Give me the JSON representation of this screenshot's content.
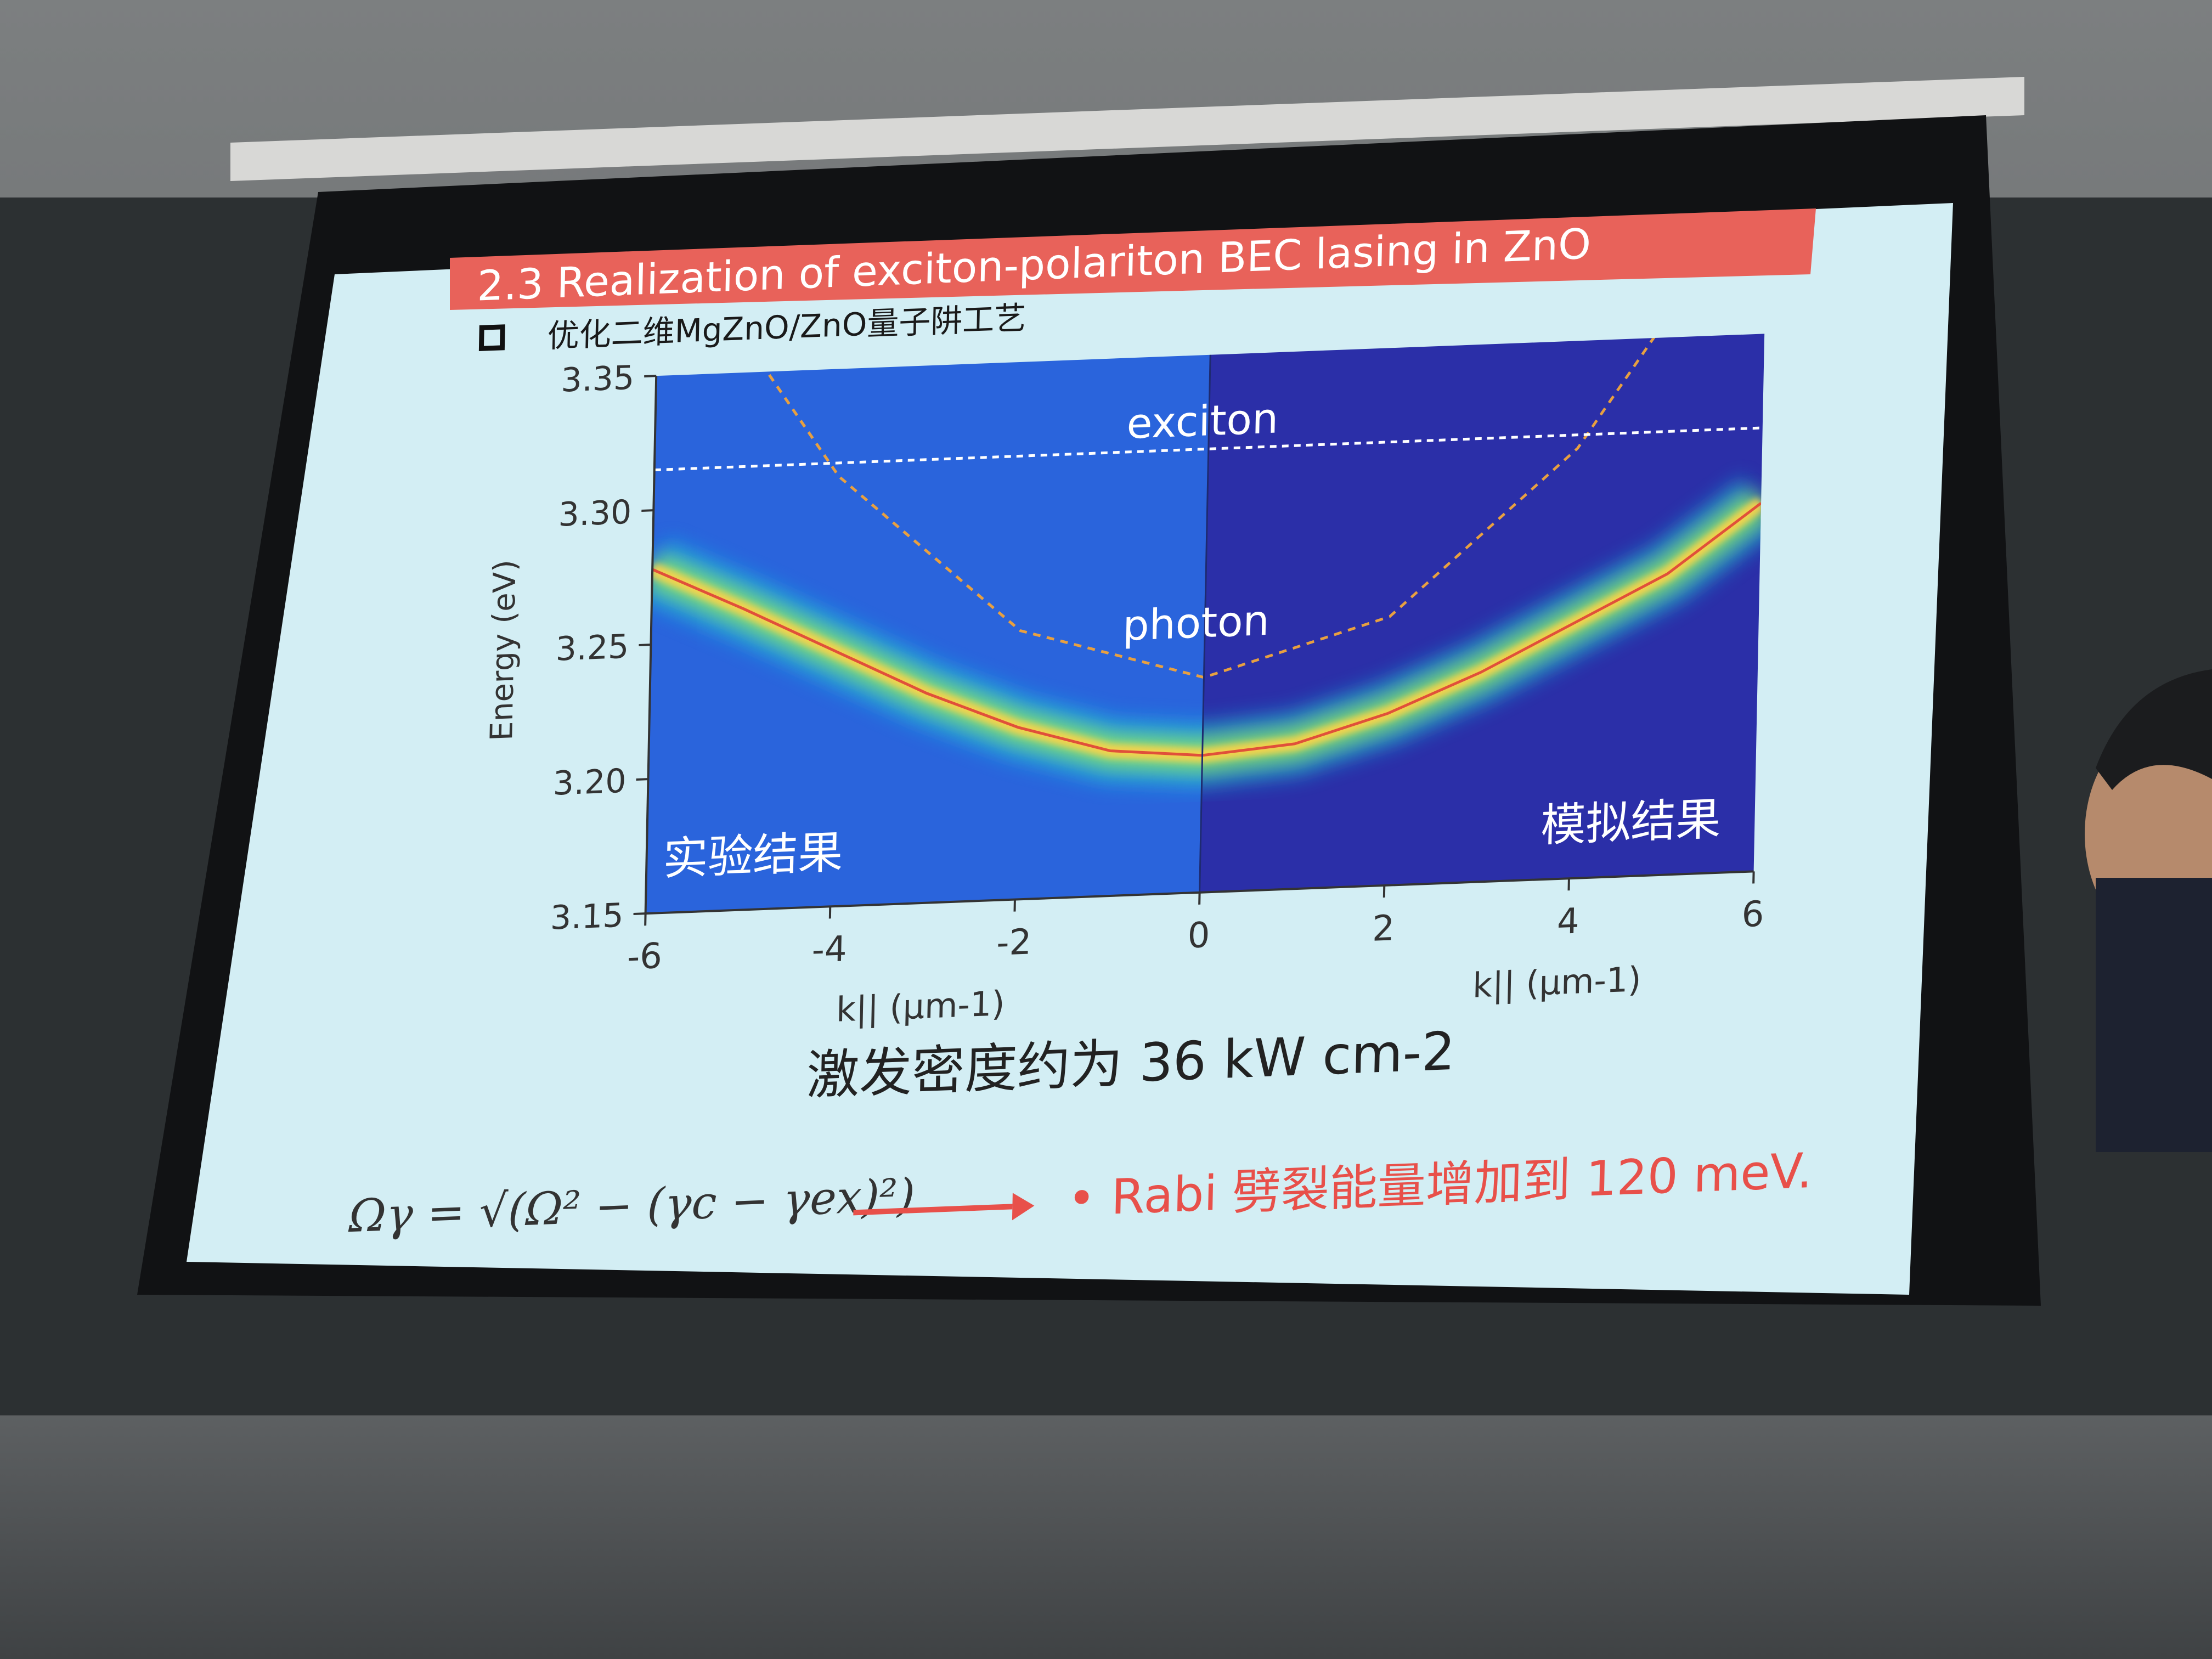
{
  "slide": {
    "title": "2.3 Realization of exciton-polariton BEC lasing in ZnO",
    "bullet_text": "优化二维MgZnO/ZnO量子阱工艺",
    "excitation_caption": "激发密度约为 36 kW cm-2",
    "formula": "Ωγ = √(Ω² − (γc − γex)²)",
    "conclusion": "• Rabi 劈裂能量增加到 120 meV.",
    "colors": {
      "title_bar": "#e8625a",
      "conclusion_text": "#e8504a",
      "arrow": "#e8504a",
      "slide_background": "#d6f0f6"
    }
  },
  "chart_data": {
    "type": "heatmap",
    "ylabel": "Energy (eV)",
    "xlabel_left": "k|| (μm-1)",
    "xlabel_right": "k|| (μm-1)",
    "xlim": [
      -6,
      6
    ],
    "ylim": [
      3.15,
      3.35
    ],
    "x_ticks": [
      "-6",
      "-4",
      "-2",
      "0",
      "2",
      "4",
      "6"
    ],
    "y_ticks": [
      "3.15",
      "3.20",
      "3.25",
      "3.30",
      "3.35"
    ],
    "panel_left_label": "实验结果",
    "panel_right_label": "模拟结果",
    "curve_labels": {
      "exciton": "exciton",
      "photon": "photon"
    },
    "exciton_energy": 3.315,
    "photon_curve": {
      "x": [
        -6,
        -4,
        -2,
        0,
        2,
        4,
        6
      ],
      "y": [
        3.41,
        3.31,
        3.25,
        3.23,
        3.25,
        3.31,
        3.41
      ]
    },
    "lower_polariton": {
      "x": [
        -6,
        -5,
        -4,
        -3,
        -2,
        -1,
        0,
        1,
        2,
        3,
        4,
        5,
        6
      ],
      "y": [
        3.278,
        3.262,
        3.245,
        3.228,
        3.214,
        3.204,
        3.201,
        3.204,
        3.214,
        3.228,
        3.245,
        3.262,
        3.287
      ]
    }
  }
}
